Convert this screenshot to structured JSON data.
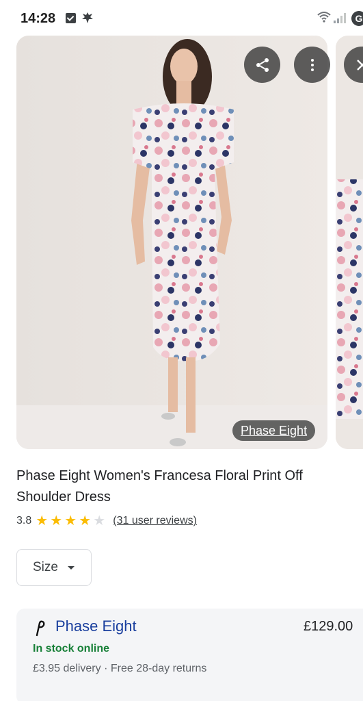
{
  "status_bar": {
    "time": "14:28",
    "wifi_label": "5",
    "badge": "G"
  },
  "carousel": {
    "brand_chip": "Phase Eight",
    "share_icon": "share-icon",
    "more_icon": "more-vert-icon",
    "close_icon": "close-icon"
  },
  "product": {
    "title": "Phase Eight Women's Francesa Floral Print Off Shoulder Dress",
    "rating": "3.8",
    "rating_stars": 3.8,
    "reviews_link": "(31 user reviews)"
  },
  "size_select": {
    "label": "Size"
  },
  "offer": {
    "merchant": "Phase Eight",
    "price": "£129.00",
    "stock": "In stock online",
    "delivery": "£3.95 delivery",
    "separator": "·",
    "returns": "Free 28-day returns"
  },
  "colors": {
    "star_filled": "#fbbc04",
    "star_empty": "#dadce0",
    "merchant_link": "#1a3f9e",
    "in_stock": "#188038"
  }
}
